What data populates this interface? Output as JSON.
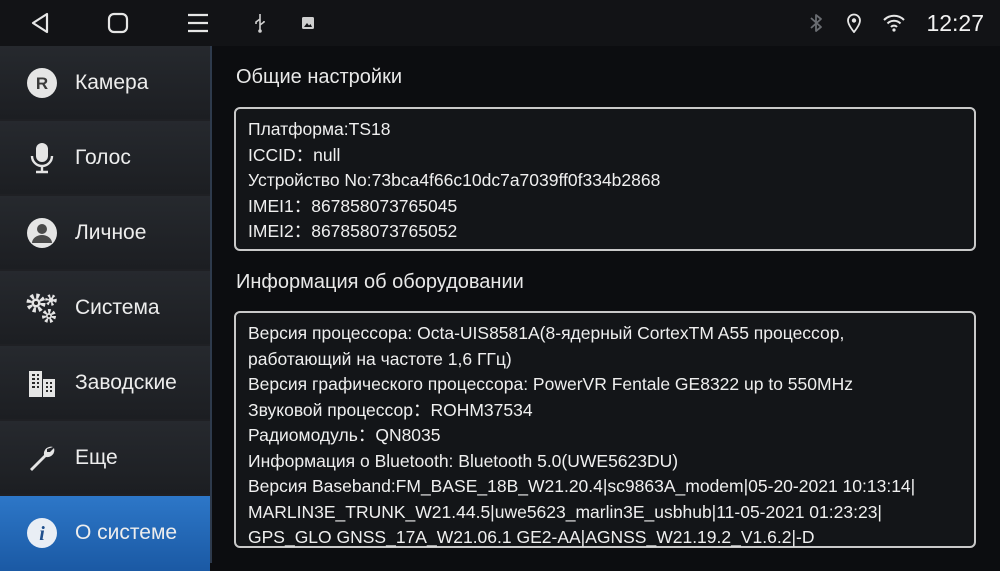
{
  "status_bar": {
    "time": "12:27",
    "nav_icons": [
      "back-icon",
      "home-icon",
      "menu-icon"
    ],
    "notif_icons": [
      "usb-icon",
      "image-icon"
    ],
    "system_icons": [
      "bluetooth-icon",
      "location-icon",
      "wifi-icon"
    ]
  },
  "sidebar": {
    "items": [
      {
        "label": "Камера",
        "icon": "camera-r-icon"
      },
      {
        "label": "Голос",
        "icon": "microphone-icon"
      },
      {
        "label": "Личное",
        "icon": "person-icon"
      },
      {
        "label": "Система",
        "icon": "gears-icon"
      },
      {
        "label": "Заводские",
        "icon": "buildings-icon"
      },
      {
        "label": "Еще",
        "icon": "wrench-icon"
      },
      {
        "label": "О системе",
        "icon": "info-icon",
        "active": true
      }
    ]
  },
  "general": {
    "title": "Общие настройки",
    "lines": [
      "Платформа:TS18",
      "ICCID：null",
      "Устройство No:73bca4f66c10dc7a7039ff0f334b2868",
      "IMEI1：867858073765045",
      "IMEI2：867858073765052"
    ]
  },
  "hardware": {
    "title": "Информация об оборудовании",
    "lines": [
      "Версия процессора: Octa-UIS8581A(8-ядерный CortexTM A55 процессор,",
      "работающий на частоте 1,6 ГГц)",
      "Версия графического процессора: PowerVR Fentale GE8322 up to 550MHz",
      "Звуковой процессор：ROHM37534",
      "Радиомодуль：QN8035",
      "Информация о Bluetooth: Bluetooth 5.0(UWE5623DU)",
      "Версия Baseband:FM_BASE_18B_W21.20.4|sc9863A_modem|05-20-2021 10:13:14|",
      "MARLIN3E_TRUNK_W21.44.5|uwe5623_marlin3E_usbhub|11-05-2021 01:23:23|",
      "GPS_GLO GNSS_17A_W21.06.1 GE2-AA|AGNSS_W21.19.2_V1.6.2|-D"
    ]
  },
  "colors": {
    "accent": "#1f63b3",
    "panel_border": "#c9c9c9",
    "background": "#0c0d10"
  }
}
